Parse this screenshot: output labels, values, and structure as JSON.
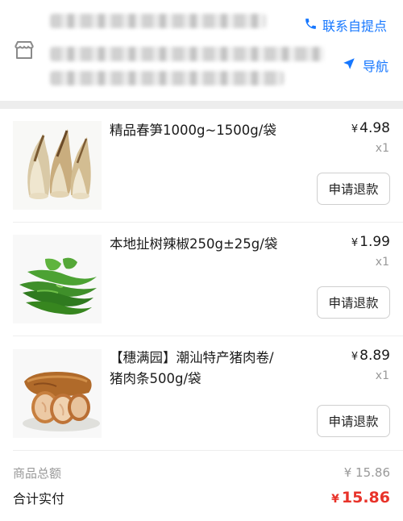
{
  "header": {
    "contact_label": "联系自提点",
    "nav_label": "导航",
    "contact_icon": "phone-icon",
    "nav_icon": "navigation-arrow-icon",
    "store_icon": "store-icon",
    "accent_color": "#1677ff"
  },
  "items": [
    {
      "name": "精品春笋1000g~1500g/袋",
      "currency": "¥",
      "price": "4.98",
      "qty": "x1",
      "refund_label": "申请退款",
      "image": "bamboo-shoots-image"
    },
    {
      "name": "本地扯树辣椒250g±25g/袋",
      "currency": "¥",
      "price": "1.99",
      "qty": "x1",
      "refund_label": "申请退款",
      "image": "green-chili-peppers-image"
    },
    {
      "name": "【穗满园】潮汕特产猪肉卷/猪肉条500g/袋",
      "currency": "¥",
      "price": "8.89",
      "qty": "x1",
      "refund_label": "申请退款",
      "image": "pork-roll-image"
    }
  ],
  "summary": {
    "subtotal_label": "商品总额",
    "subtotal_value": "¥ 15.86",
    "total_label": "合计实付",
    "total_currency": "¥",
    "total_value": "15.86",
    "total_color": "#e8332a"
  }
}
